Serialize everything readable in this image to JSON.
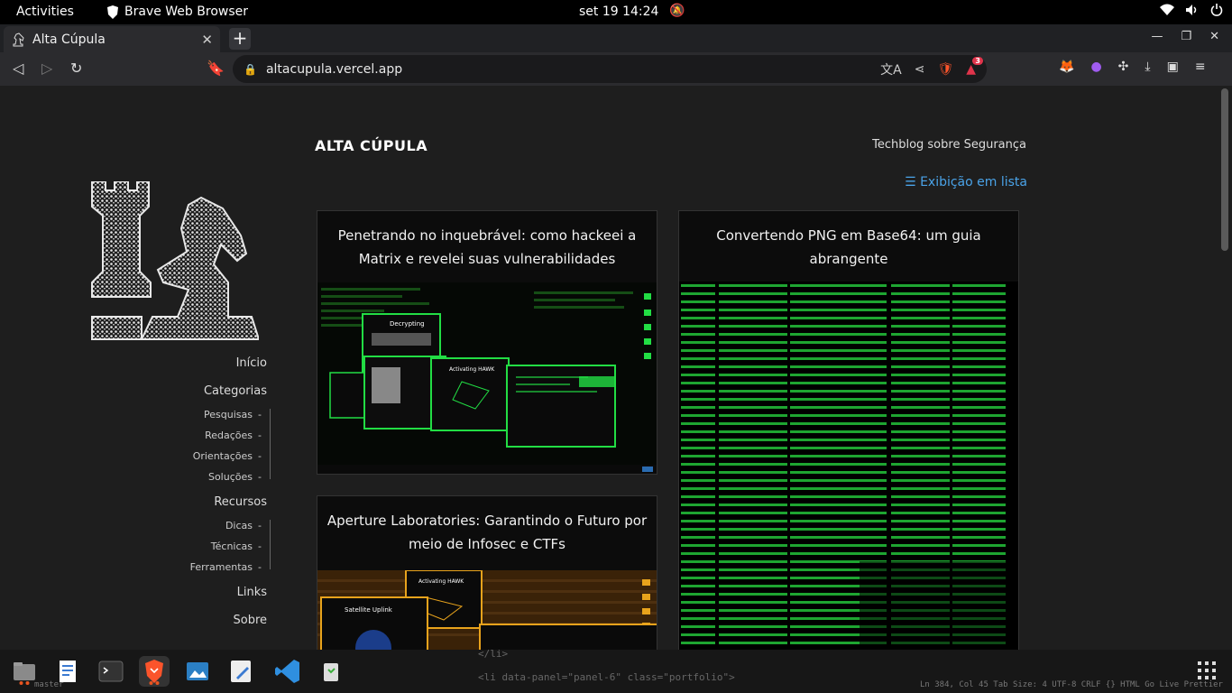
{
  "topbar": {
    "activities": "Activities",
    "app_name": "Brave Web Browser",
    "clock": "set 19  14:24"
  },
  "tab": {
    "title": "Alta Cúpula",
    "close": "✕",
    "new_tab": "+"
  },
  "toolbar": {
    "url": "altacupula.vercel.app",
    "shield_badge": "3"
  },
  "site": {
    "title": "ALTA CÚPULA",
    "subtitle": "Techblog sobre Segurança",
    "view_toggle": "☰ Exibição em lista"
  },
  "nav": {
    "home": "Início",
    "categories": "Categorias",
    "categories_sub": [
      "Pesquisas",
      "Redações",
      "Orientações",
      "Soluções"
    ],
    "resources": "Recursos",
    "resources_sub": [
      "Dicas",
      "Técnicas",
      "Ferramentas"
    ],
    "links": "Links",
    "about": "Sobre"
  },
  "posts": [
    {
      "title": "Penetrando no inquebrável: como hackeei a Matrix e revelei suas vulnerabilidades"
    },
    {
      "title": "Convertendo PNG em Base64: um guia abrangente"
    },
    {
      "title": "Aperture Laboratories: Garantindo o Futuro por meio de Infosec e CTFs"
    }
  ],
  "thumb_text": {
    "decrypting": "Decrypting",
    "activating_hawk": "Activating HAWK",
    "satellite_uplink": "Satellite Uplink"
  },
  "taskbar": {
    "code_line_1": "</li>",
    "code_line_2": "<li data-panel=\"panel-6\" class=\"portfolio\">",
    "status_left": "master",
    "status_right": "Ln 384, Col 45   Tab Size: 4   UTF-8   CRLF   {} HTML   Go Live   Prettier"
  },
  "colors": {
    "accent_link": "#4aa3e8",
    "matrix_green": "#22dd44",
    "page_bg": "#1e1e1e"
  }
}
